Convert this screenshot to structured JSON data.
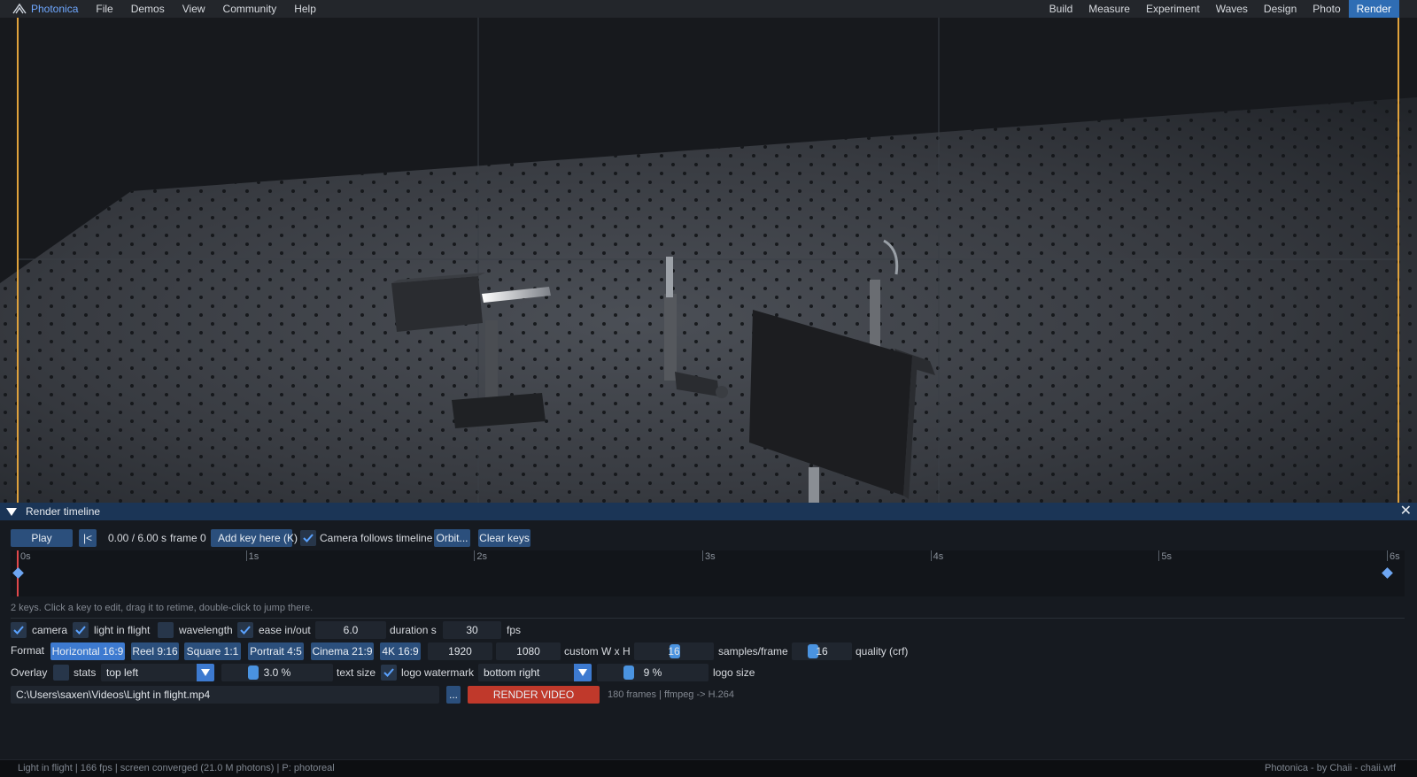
{
  "menubar": {
    "app_name": "Photonica",
    "left": [
      "File",
      "Demos",
      "View",
      "Community",
      "Help"
    ],
    "right": [
      "Build",
      "Measure",
      "Experiment",
      "Waves",
      "Design",
      "Photo",
      "Render"
    ],
    "active": "Render"
  },
  "panel": {
    "title": "Render timeline",
    "play_label": "Play",
    "rewind_label": "|<",
    "time_readout": "0.00 / 6.00 s",
    "frame_readout": "frame 0",
    "add_key_label": "Add key here (K)",
    "camera_follows_label": "Camera follows timeline",
    "camera_follows_checked": true,
    "orbit_label": "Orbit...",
    "clear_keys_label": "Clear keys",
    "timeline": {
      "ticks": [
        "0s",
        "1s",
        "2s",
        "3s",
        "4s",
        "5s",
        "6s"
      ],
      "duration_s": 6.0,
      "playhead_s": 0.0,
      "keys_s": [
        0.0,
        6.0
      ],
      "hint": "2 keys. Click a key to edit, drag it to retime, double-click to jump there."
    },
    "options": {
      "camera_label": "camera",
      "camera_checked": true,
      "light_label": "light in flight",
      "light_checked": true,
      "wavelength_label": "wavelength",
      "wavelength_checked": false,
      "ease_label": "ease in/out",
      "ease_checked": true,
      "duration_value": "6.0",
      "duration_label": "duration s",
      "fps_value": "30",
      "fps_label": "fps"
    },
    "format": {
      "label": "Format",
      "presets": [
        "Horizontal 16:9",
        "Reel 9:16",
        "Square 1:1",
        "Portrait 4:5",
        "Cinema 21:9",
        "4K 16:9"
      ],
      "active": "Horizontal 16:9",
      "width": "1920",
      "height": "1080",
      "custom_label": "custom W x H",
      "samples_value": "16",
      "samples_label": "samples/frame",
      "samples_fraction": 0.5,
      "quality_value": "16",
      "quality_label": "quality (crf)",
      "quality_fraction": 0.3
    },
    "overlay": {
      "label": "Overlay",
      "stats_label": "stats",
      "stats_checked": false,
      "stats_position": "top left",
      "text_size_value": "3.0 %",
      "text_size_label": "text size",
      "text_size_fraction": 0.25,
      "logo_label": "logo watermark",
      "logo_checked": true,
      "logo_position": "bottom right",
      "logo_size_value": "9 %",
      "logo_size_label": "logo size",
      "logo_size_fraction": 0.25
    },
    "output": {
      "path": "C:\\Users\\saxen\\Videos\\Light in flight.mp4",
      "browse_label": "...",
      "render_label": "RENDER VIDEO",
      "info": "180 frames  |  ffmpeg -> H.264"
    }
  },
  "status": {
    "left": "Light in flight  |  166 fps  |  screen converged (21.0 M photons)  |  P: photoreal",
    "right": "Photonica  -  by Chaii  -  chaii.wtf"
  },
  "colors": {
    "accent": "#2f6db4",
    "render_button": "#c0392b",
    "playhead": "#e0474b",
    "key": "#6ea6f2"
  }
}
